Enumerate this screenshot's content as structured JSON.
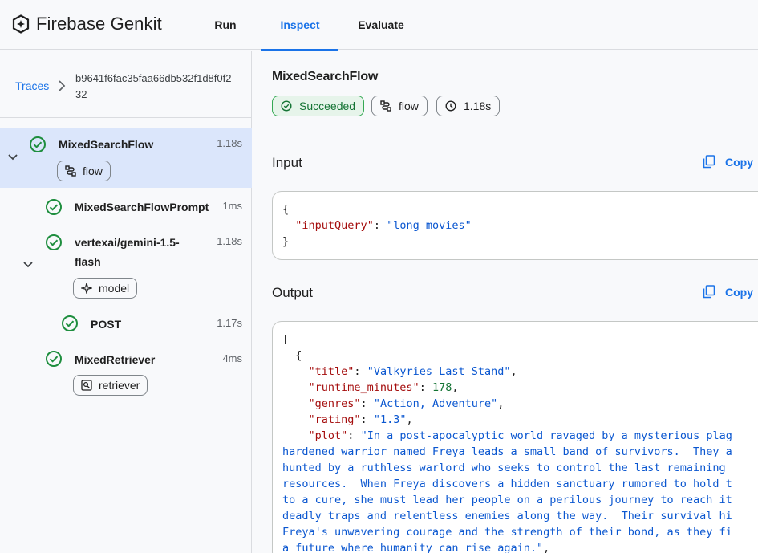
{
  "app": {
    "brand": "Firebase Genkit"
  },
  "nav": {
    "tabs": [
      {
        "label": "Run"
      },
      {
        "label": "Inspect"
      },
      {
        "label": "Evaluate"
      }
    ],
    "active": "Inspect"
  },
  "breadcrumb": {
    "link": "Traces",
    "trace_id": "b9641f6fac35faa66db532f1d8f0f232"
  },
  "spans": [
    {
      "name": "MixedSearchFlow",
      "time": "1.18s",
      "chip": "flow",
      "selected": true
    },
    {
      "name": "MixedSearchFlowPrompt",
      "time": "1ms"
    },
    {
      "name": "vertexai/gemini-1.5-flash",
      "name_line1": "vertexai/gemini-1.5-",
      "name_line2": "flash",
      "time": "1.18s",
      "chip": "model"
    },
    {
      "name": "POST",
      "time": "1.17s"
    },
    {
      "name": "MixedRetriever",
      "time": "4ms",
      "chip": "retriever"
    }
  ],
  "detail": {
    "title": "MixedSearchFlow",
    "status": "Succeeded",
    "type": "flow",
    "duration": "1.18s"
  },
  "input": {
    "label": "Input",
    "copy_label": "Copy",
    "lines": [
      "{",
      "  \"inputQuery\": \"long movies\"",
      "}"
    ],
    "key": "inputQuery",
    "value": "long movies"
  },
  "output": {
    "label": "Output",
    "copy_label": "Copy",
    "item": {
      "title": "Valkyries Last Stand",
      "runtime_minutes": "178",
      "genres": "Action, Adventure",
      "rating": "1.3",
      "plot_lines": [
        "\"In a post-apocalyptic world ravaged by a mysterious plag",
        "hardened warrior named Freya leads a small band of survivors.  They a",
        "hunted by a ruthless warlord who seeks to control the last remaining",
        "resources.  When Freya discovers a hidden sanctuary rumored to hold t",
        "to a cure, she must lead her people on a perilous journey to reach it",
        "deadly traps and relentless enemies along the way.  Their survival hi",
        "Freya's unwavering courage and the strength of their bond, as they fi",
        "a future where humanity can rise again.\""
      ]
    }
  },
  "colors": {
    "accent": "#1a73e8",
    "success": "#34a853",
    "selected_row": "#dbe6fb"
  },
  "icons": [
    "genkit-logo-icon",
    "chevron-right-icon",
    "check-circle-icon",
    "chevron-down-icon",
    "flow-icon",
    "sparkle-icon",
    "retriever-icon",
    "clock-icon",
    "copy-icon"
  ]
}
